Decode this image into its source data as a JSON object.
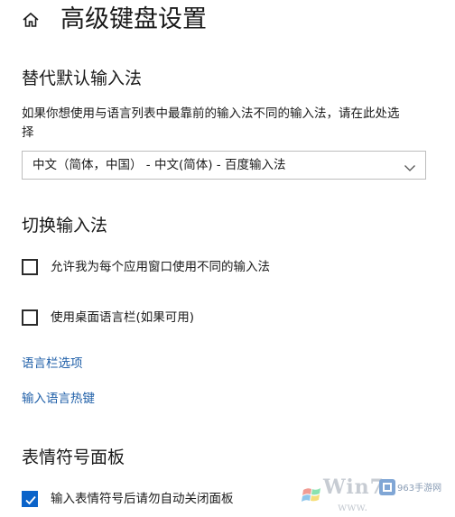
{
  "page": {
    "title": "高级键盘设置"
  },
  "override_section": {
    "title": "替代默认输入法",
    "description": "如果你想使用与语言列表中最靠前的输入法不同的输入法，请在此处选择",
    "dropdown_value": "中文（简体，中国） - 中文(简体) - 百度输入法"
  },
  "switch_section": {
    "title": "切换输入法",
    "checkboxes": [
      {
        "label": "允许我为每个应用窗口使用不同的输入法",
        "checked": false
      },
      {
        "label": "使用桌面语言栏(如果可用)",
        "checked": false
      }
    ],
    "links": [
      {
        "label": "语言栏选项"
      },
      {
        "label": "输入语言热键"
      }
    ]
  },
  "emoji_section": {
    "title": "表情符号面板",
    "checkboxes": [
      {
        "label": "输入表情符号后请勿自动关闭面板",
        "checked": true
      }
    ]
  },
  "colors": {
    "accent": "#0a63c9",
    "link": "#1f5fa8",
    "text": "#1a1a1a"
  },
  "icons": {
    "home": "home-icon",
    "dropdown": "chevron-down-icon",
    "check": "check-icon"
  }
}
